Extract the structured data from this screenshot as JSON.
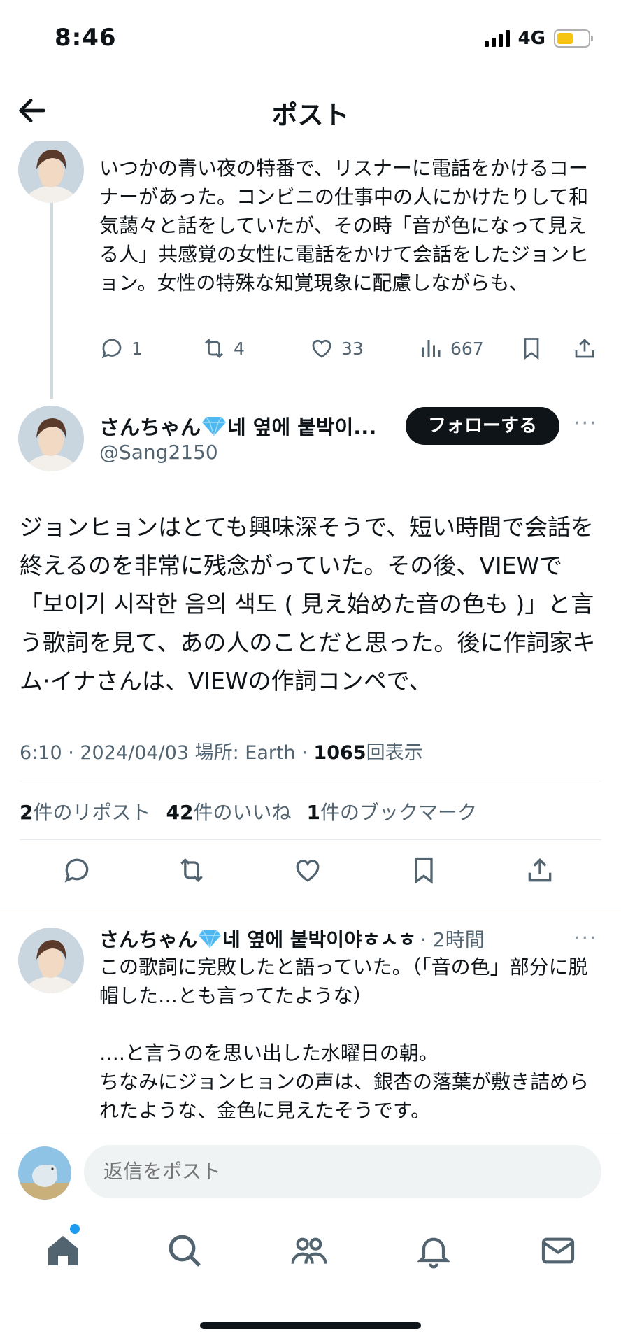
{
  "status_bar": {
    "time": "8:46",
    "network": "4G"
  },
  "header": {
    "title": "ポスト"
  },
  "thread_tweet": {
    "text": "いつかの青い夜の特番で、リスナーに電話をかけるコーナーがあった。コンビニの仕事中の人にかけたりして和気藹々と話をしていたが、その時「音が色になって見える人」共感覚の女性に電話をかけて会話をしたジョンヒョン。女性の特殊な知覚現象に配慮しながらも、",
    "replies": "1",
    "reposts": "4",
    "likes": "33",
    "views": "667"
  },
  "main_tweet": {
    "name_prefix": "さんちゃん",
    "name_suffix": "네 옆에 붙박이...",
    "handle": "@Sang2150",
    "follow_label": "フォローする",
    "more": "···",
    "body": "ジョンヒョンはとても興味深そうで、短い時間で会話を終えるのを非常に残念がっていた。その後、VIEWで「보이기 시작한 음의 색도 ( 見え始めた音の色も )」と言う歌詞を見て、あの人のことだと思った。後に作詞家キム·イナさんは、VIEWの作詞コンペで、",
    "meta_prefix": "6:10 · 2024/04/03 場所: Earth · ",
    "view_count": "1065",
    "view_label": "回表示",
    "reposts_count": "2",
    "reposts_label": "件のリポスト",
    "likes_count": "42",
    "likes_label": "件のいいね",
    "bookmarks_count": "1",
    "bookmarks_label": "件のブックマーク"
  },
  "reply_tweet": {
    "name_prefix": "さんちゃん",
    "name_suffix": "네 옆에 붙박이야ㅎㅅㅎ",
    "time": "· 2時間",
    "more": "···",
    "text": "この歌詞に完敗したと語っていた。（「音の色」部分に脱帽した…とも言ってたような）\n\n….と言うのを思い出した水曜日の朝。\nちなみにジョンヒョンの声は、銀杏の落葉が敷き詰められたような、金色に見えたそうです。"
  },
  "reply_bar": {
    "placeholder": "返信をポスト"
  },
  "colors": {
    "accent": "#1d9bf0",
    "text": "#0f1419",
    "secondary": "#536471",
    "gem": "#4fb8f0"
  },
  "icons": [
    "back-arrow-icon",
    "reply-icon",
    "repost-icon",
    "like-icon",
    "views-icon",
    "bookmark-icon",
    "share-icon",
    "home-icon",
    "search-icon",
    "communities-icon",
    "notifications-icon",
    "messages-icon"
  ]
}
